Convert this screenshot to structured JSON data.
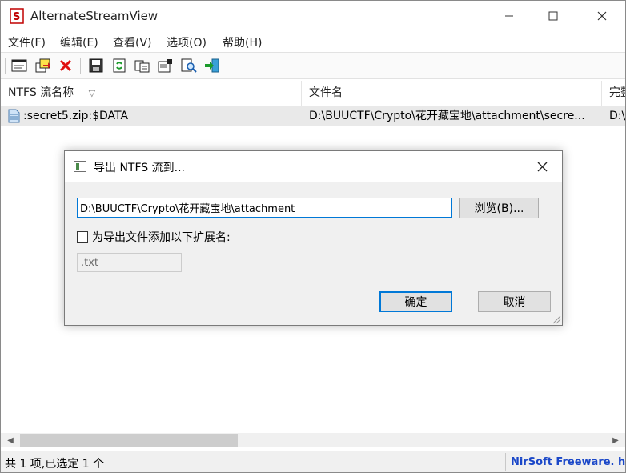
{
  "window": {
    "title": "AlternateStreamView",
    "controls": {
      "minimize": "—",
      "maximize": "☐",
      "close": "✕"
    }
  },
  "menu": [
    "文件(F)",
    "编辑(E)",
    "查看(V)",
    "选项(O)",
    "帮助(H)"
  ],
  "toolbar": {
    "icons": [
      "properties-icon",
      "export-icon",
      "delete-icon",
      "save-icon",
      "refresh-icon",
      "copy-icon",
      "options-icon",
      "find-icon",
      "exit-icon"
    ]
  },
  "columns": [
    "NTFS 流名称",
    "文件名",
    "完整"
  ],
  "sort_indicator": "▽",
  "rows": [
    {
      "stream": ":secret5.zip:$DATA",
      "file": "D:\\BUUCTF\\Crypto\\花开藏宝地\\attachment\\secre...",
      "full": "D:\\"
    }
  ],
  "status": {
    "left": "共 1 项,已选定 1 个",
    "right": "NirSoft Freeware.  http"
  },
  "dialog": {
    "title": "导出 NTFS 流到...",
    "path_value": "D:\\BUUCTF\\Crypto\\花开藏宝地\\attachment",
    "browse_label": "浏览(B)...",
    "checkbox_label": "为导出文件添加以下扩展名:",
    "checkbox_checked": false,
    "extension_value": ".txt",
    "ok_label": "确定",
    "cancel_label": "取消"
  },
  "colors": {
    "accent": "#0078d7",
    "row_highlight": "#e9e9e9",
    "nirsoft_link": "#1a47c8",
    "delete_red": "#e01010"
  }
}
